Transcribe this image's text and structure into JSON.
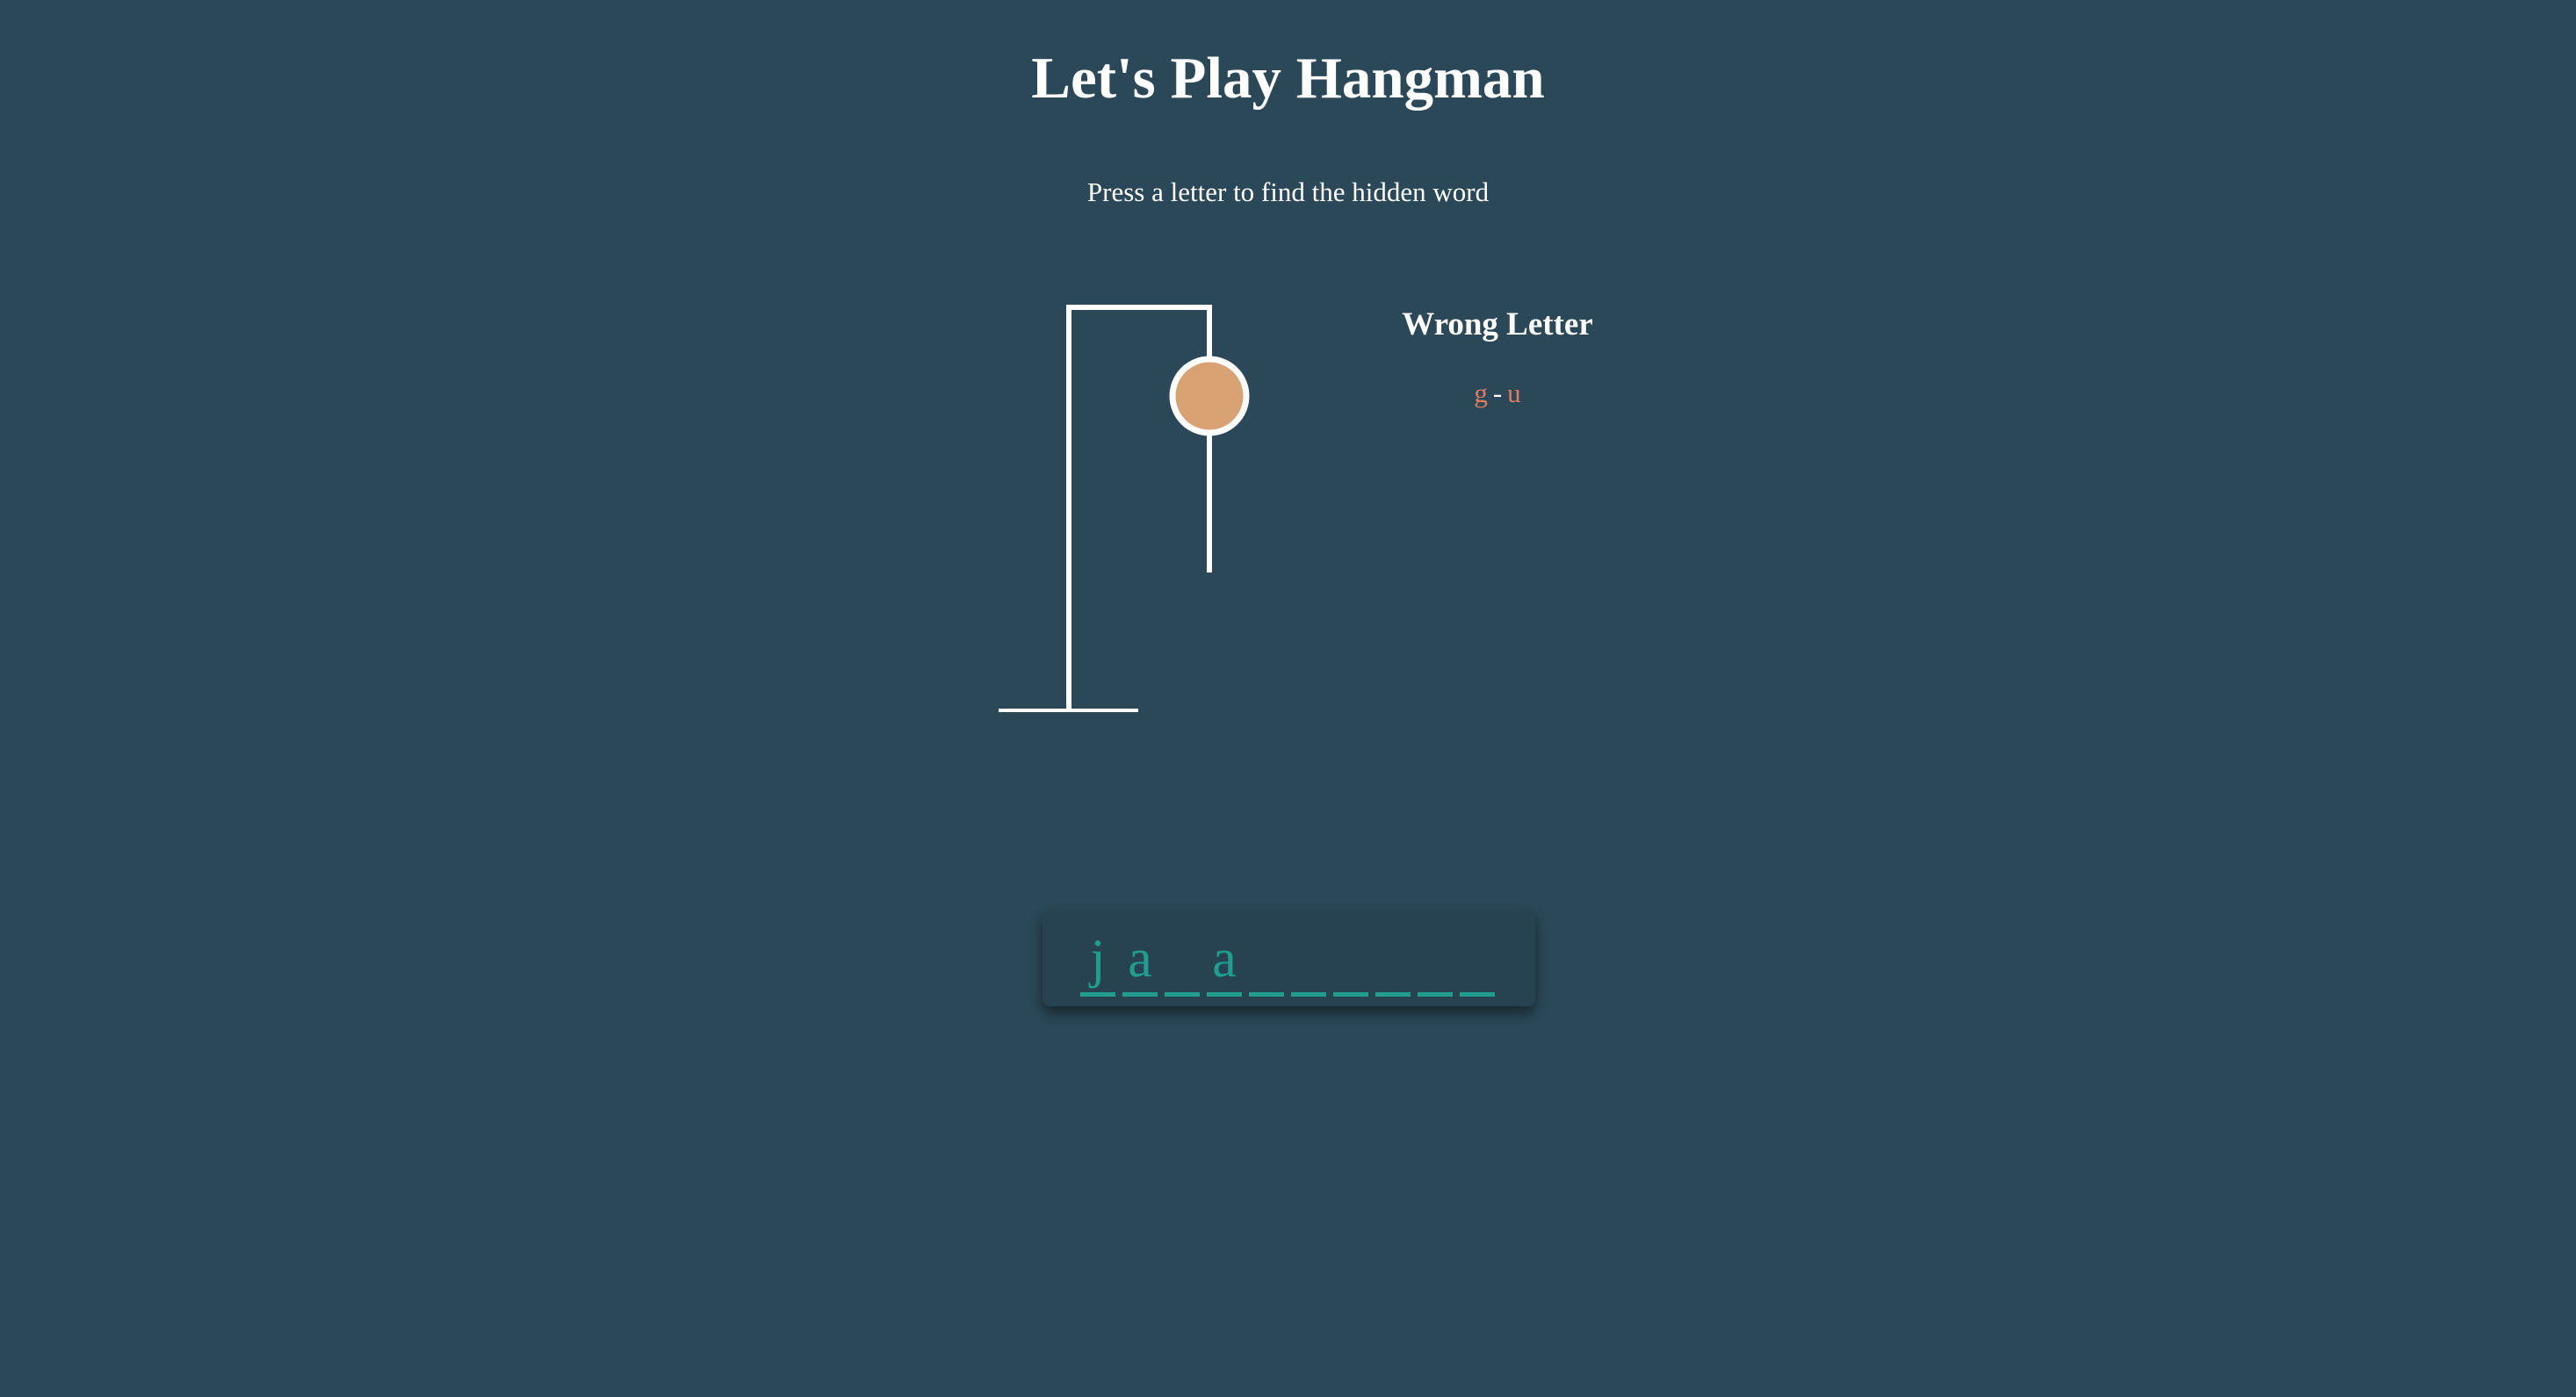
{
  "header": {
    "title": "Let's Play Hangman",
    "subtitle": "Press a letter to find the hidden word"
  },
  "wrong_letters": {
    "title": "Wrong Letter",
    "letters": [
      "g",
      "u"
    ],
    "separator": "-"
  },
  "word": {
    "slots": [
      "j",
      "a",
      "",
      "a",
      "",
      "",
      "",
      "",
      "",
      ""
    ]
  },
  "hangman": {
    "parts_shown": [
      "base",
      "pole",
      "beam",
      "rope",
      "head",
      "body"
    ],
    "head_color": "#d9a273",
    "line_color": "#ffffff"
  },
  "colors": {
    "background": "#2a4858",
    "wrong_letter": "#e07a5f",
    "word_accent": "#1f9e8f"
  }
}
